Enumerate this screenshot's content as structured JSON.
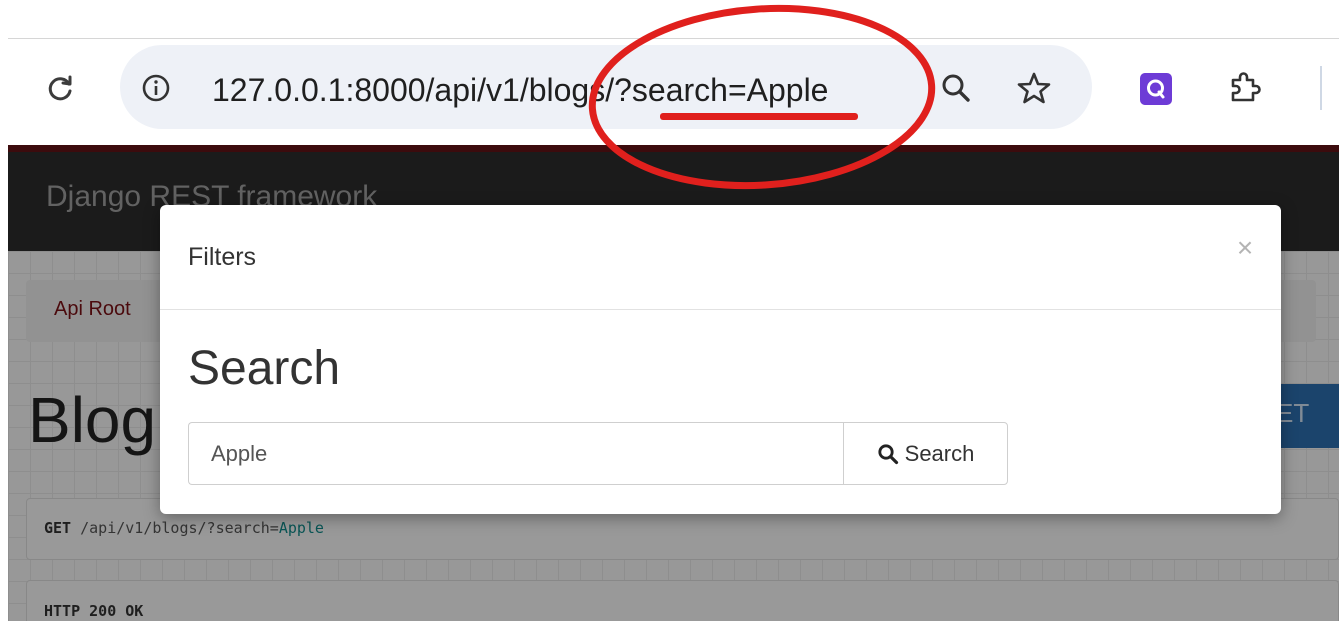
{
  "browser": {
    "url": "127.0.0.1:8000/api/v1/blogs/?search=Apple",
    "icons": [
      "reload-icon",
      "site-info-icon",
      "zoom-icon",
      "bookmark-star-icon",
      "extension-q-icon",
      "extensions-puzzle-icon"
    ]
  },
  "annotation": {
    "color": "#e0201d"
  },
  "page": {
    "brand": "Django REST framework",
    "breadcrumb": "Api Root",
    "title": "Blog",
    "get_button_partial": "ET",
    "request": {
      "method": "GET",
      "path": "/api/v1/blogs/?search=",
      "value": "Apple"
    },
    "response_status": "HTTP 200 OK"
  },
  "modal": {
    "title": "Filters",
    "close_symbol": "×",
    "section_title": "Search",
    "search_value": "Apple",
    "search_button_label": "Search"
  },
  "colors": {
    "navbar": "#2c2c2c",
    "navbar_accent": "#611316",
    "link": "#7a1116",
    "primary_button": "#2c6fae"
  }
}
